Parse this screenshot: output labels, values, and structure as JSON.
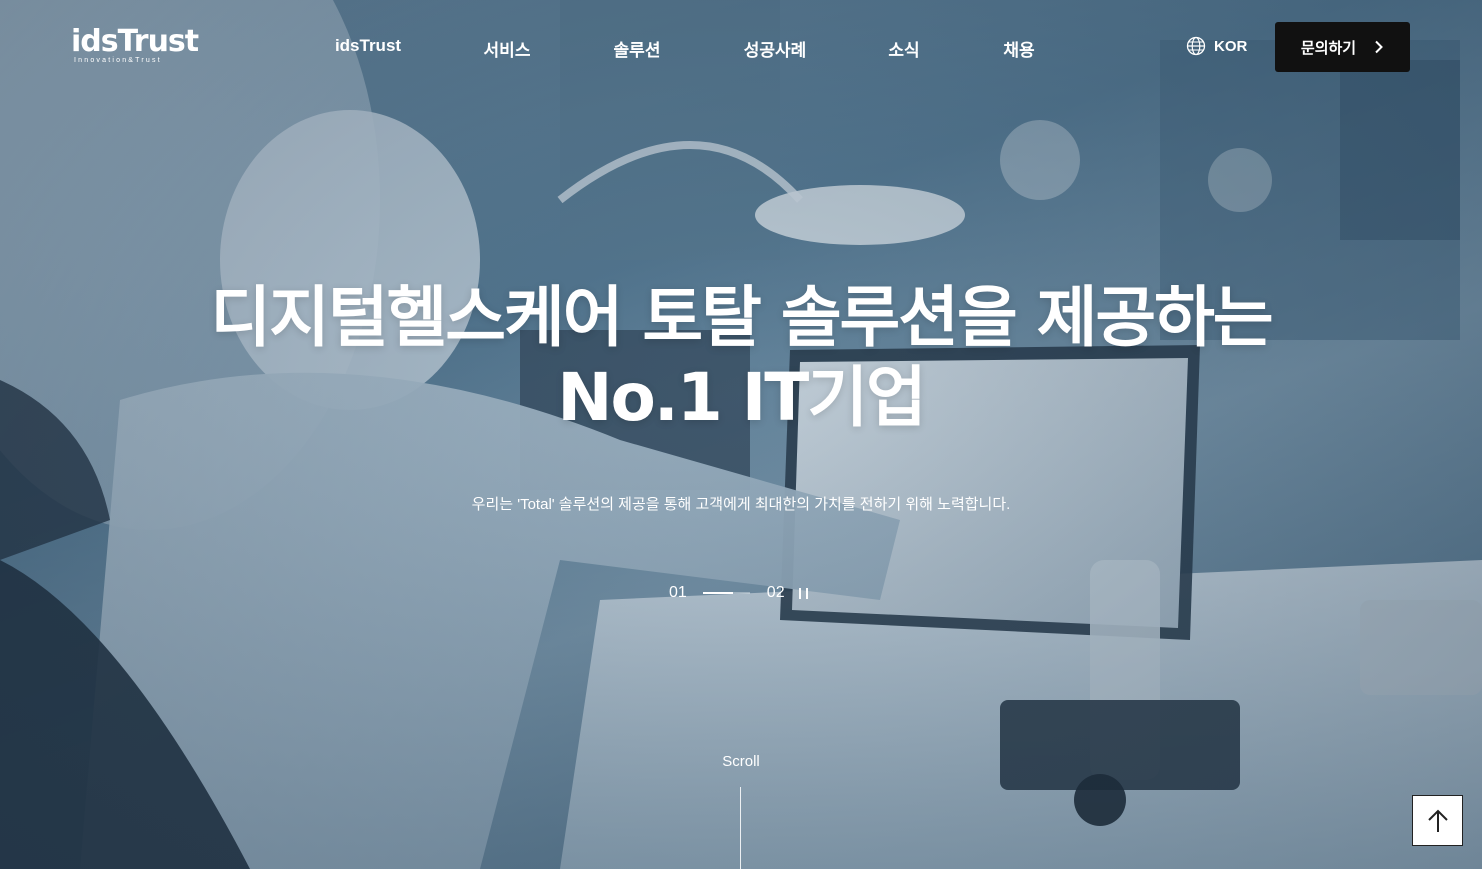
{
  "brand": {
    "logo_text": "idsTrust",
    "logo_tagline": "Innovation&Trust"
  },
  "nav": {
    "items": [
      {
        "label": "idsTrust"
      },
      {
        "label": "서비스"
      },
      {
        "label": "솔루션"
      },
      {
        "label": "성공사례"
      },
      {
        "label": "소식"
      },
      {
        "label": "채용"
      }
    ]
  },
  "language": {
    "icon": "globe-icon",
    "label": "KOR"
  },
  "cta": {
    "label": "문의하기",
    "icon": "chevron-right-icon"
  },
  "hero": {
    "headline_line1": "디지털헬스케어 토탈 솔루션을 제공하는",
    "headline_line2": "No.1 IT기업",
    "subtitle": "우리는 'Total' 솔루션의 제공을 통해 고객에게 최대한의 가치를 전하기 위해 노력합니다."
  },
  "slider": {
    "current": "01",
    "next": "02",
    "progress": 0.65,
    "pause_icon": "pause-icon"
  },
  "scroll": {
    "label": "Scroll"
  },
  "to_top": {
    "icon": "arrow-up-icon"
  },
  "colors": {
    "cta_background": "#111111",
    "text": "#ffffff",
    "hero_tint": "#6f8fa6"
  }
}
